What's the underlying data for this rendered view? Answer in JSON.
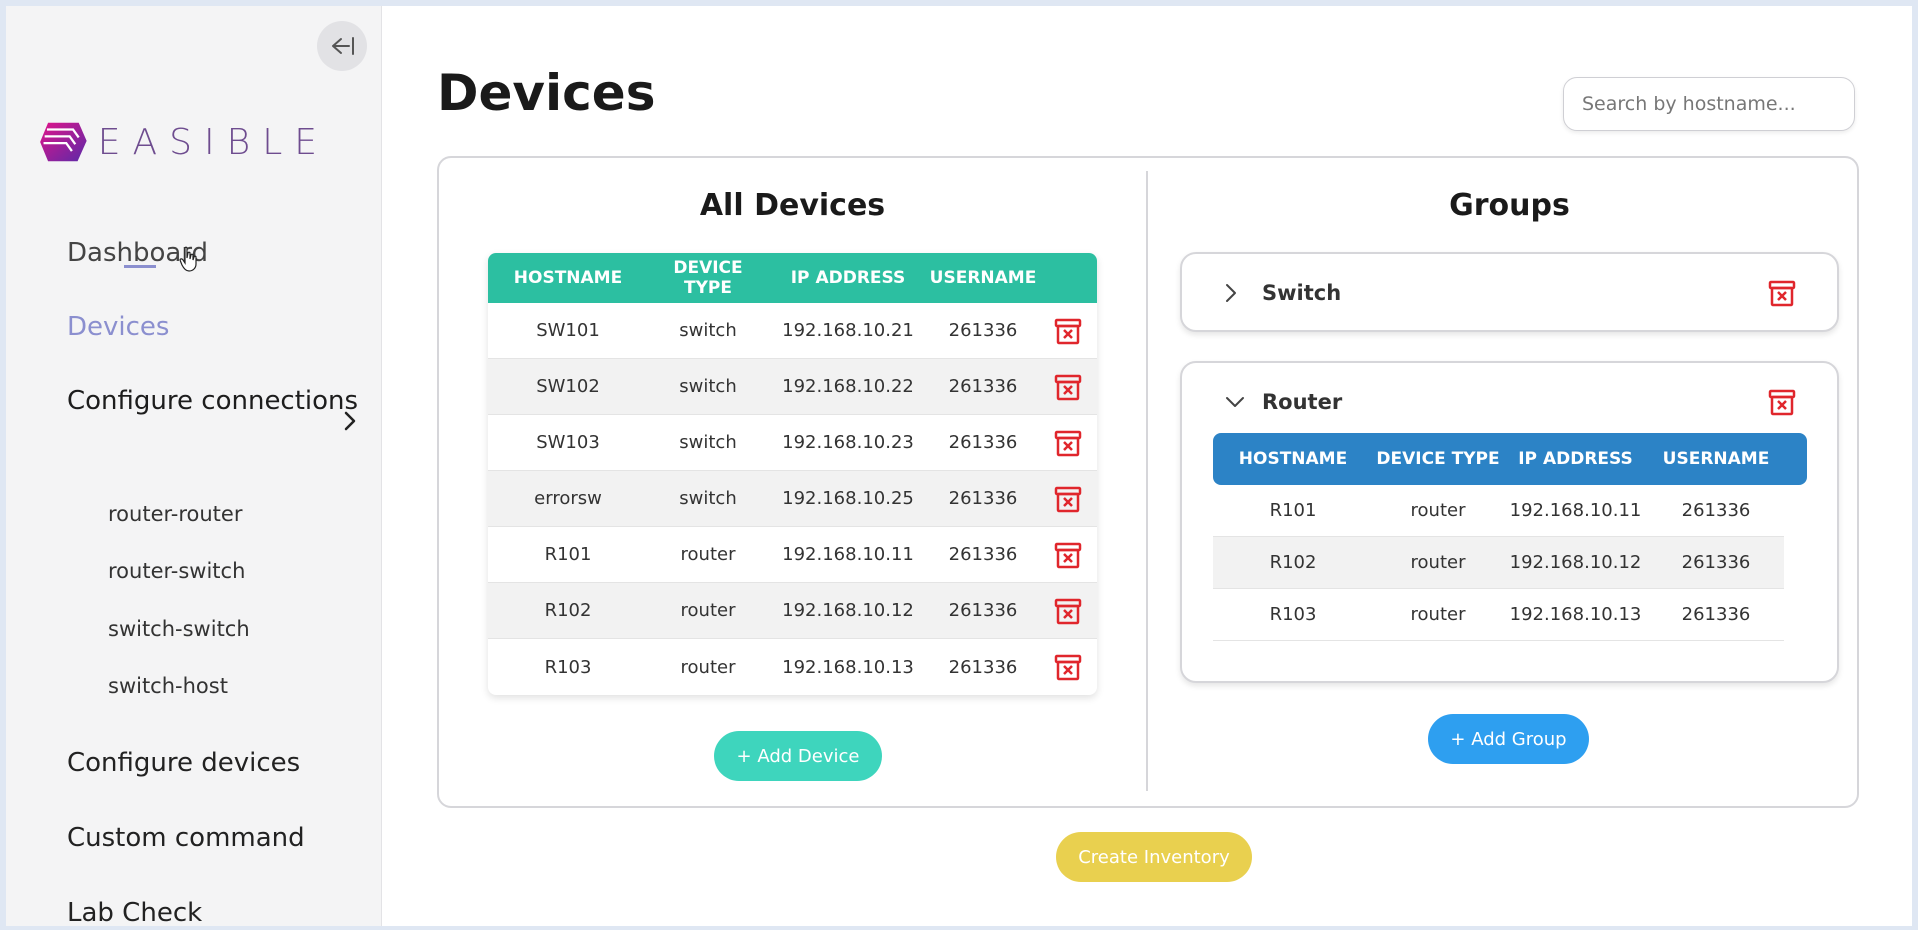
{
  "sidebar": {
    "brand": "EASIBLE",
    "nav": {
      "dashboard": "Dashboard",
      "devices": "Devices",
      "configure_connections": "Configure connections",
      "sub_items": [
        "router-router",
        "router-switch",
        "switch-switch",
        "switch-host"
      ],
      "configure_devices": "Configure devices",
      "custom_command": "Custom command",
      "lab_check": "Lab Check"
    }
  },
  "header": {
    "title": "Devices",
    "search_placeholder": "Search by hostname..."
  },
  "all_devices": {
    "title": "All Devices",
    "columns": [
      "HOSTNAME",
      "DEVICE TYPE",
      "IP ADDRESS",
      "USERNAME"
    ],
    "rows": [
      [
        "SW101",
        "switch",
        "192.168.10.21",
        "261336"
      ],
      [
        "SW102",
        "switch",
        "192.168.10.22",
        "261336"
      ],
      [
        "SW103",
        "switch",
        "192.168.10.23",
        "261336"
      ],
      [
        "errorsw",
        "switch",
        "192.168.10.25",
        "261336"
      ],
      [
        "R101",
        "router",
        "192.168.10.11",
        "261336"
      ],
      [
        "R102",
        "router",
        "192.168.10.12",
        "261336"
      ],
      [
        "R103",
        "router",
        "192.168.10.13",
        "261336"
      ]
    ],
    "add_button": "+ Add Device"
  },
  "groups": {
    "title": "Groups",
    "items": [
      {
        "name": "Switch",
        "expanded": false
      },
      {
        "name": "Router",
        "expanded": true,
        "columns": [
          "HOSTNAME",
          "DEVICE TYPE",
          "IP ADDRESS",
          "USERNAME"
        ],
        "rows": [
          [
            "R101",
            "router",
            "192.168.10.11",
            "261336"
          ],
          [
            "R102",
            "router",
            "192.168.10.12",
            "261336"
          ],
          [
            "R103",
            "router",
            "192.168.10.13",
            "261336"
          ]
        ]
      }
    ],
    "add_button": "+ Add Group"
  },
  "footer": {
    "create_inventory": "Create Inventory"
  },
  "colors": {
    "accent_teal": "#2cbfa1",
    "accent_blue": "#2c83c6",
    "add_group_blue": "#2e9ff0",
    "inventory_yellow": "#e9d04f",
    "delete_red": "#e0262c",
    "active_nav": "#8b8fcf"
  }
}
